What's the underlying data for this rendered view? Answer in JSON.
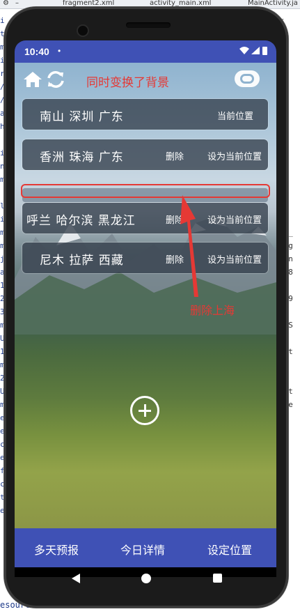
{
  "ide": {
    "tabs": [
      "fragment2.xml",
      "activity_main.xml",
      "MainActivity.ja"
    ],
    "bottom_line": "esource failed to call close."
  },
  "status_bar": {
    "time": "10:40",
    "dot": "•"
  },
  "header": {
    "note": "同时变换了背景"
  },
  "cities": [
    {
      "name": "南山 深圳 广东",
      "action": "当前位置"
    },
    {
      "name": "香洲 珠海 广东",
      "delete": "删除",
      "action": "设为当前位置"
    },
    {
      "name": "呼兰 哈尔滨 黑龙江",
      "delete": "删除",
      "action": "设为当前位置"
    },
    {
      "name": "尼木 拉萨 西藏",
      "delete": "删除",
      "action": "设为当前位置"
    }
  ],
  "annotation": {
    "arrow_note": "删除上海"
  },
  "bottom_nav": {
    "items": [
      "多天预报",
      "今日详情",
      "设定位置"
    ]
  },
  "colors": {
    "primary": "#3f51b5",
    "annotation_red": "#e53935",
    "card": "#343f4c"
  }
}
